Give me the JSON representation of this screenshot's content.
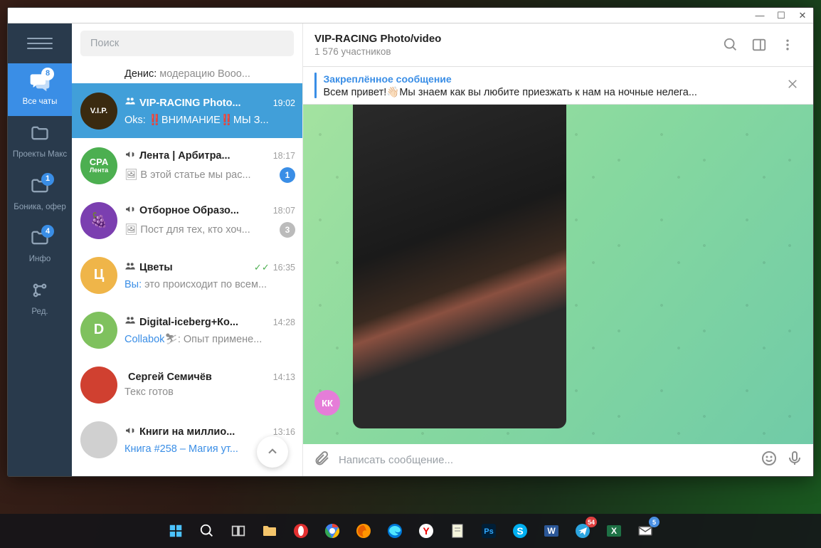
{
  "window_controls": {
    "minimize": "—",
    "maximize": "☐",
    "close": "✕"
  },
  "sidebar": {
    "tabs": [
      {
        "label": "Все чаты",
        "badge": "8",
        "icon": "chats"
      },
      {
        "label": "Проекты Макс",
        "badge": null,
        "icon": "folder"
      },
      {
        "label": "Боника, офер",
        "badge": "1",
        "icon": "folder"
      },
      {
        "label": "Инфо",
        "badge": "4",
        "icon": "folder"
      },
      {
        "label": "Ред.",
        "badge": null,
        "icon": "edit"
      }
    ]
  },
  "search": {
    "placeholder": "Поиск"
  },
  "chats": [
    {
      "type": "partial",
      "msg_html": "<span class='sender'>Денис:</span> модерацию Booo..."
    },
    {
      "type": "selected",
      "avatar": {
        "bg": "#3a2a10",
        "text": "V.I.P."
      },
      "icon": "group",
      "name": "VIP-RACING Photo...",
      "time": "19:02",
      "msg_html": "<span class='sender'>Oks:</span> ‼️ВНИМАНИЕ‼️МЫ З...",
      "badge": null
    },
    {
      "avatar": {
        "bg": "#4caf50",
        "text": "CPA"
      },
      "avatar_sub": "Лента",
      "icon": "channel",
      "name": "Лента | Арбитра...",
      "time": "18:17",
      "msg_html": "🖼 В этой статье мы рас...",
      "badge": "1",
      "badge_blue": true
    },
    {
      "avatar": {
        "bg": "#7b3fb0",
        "text": "🍇"
      },
      "icon": "channel",
      "name": "Отборное Образо...",
      "time": "18:07",
      "msg_html": "🖼 Пост для тех, кто хоч...",
      "badge": "3"
    },
    {
      "avatar": {
        "bg": "#efb549",
        "text": "Ц"
      },
      "icon": "group",
      "name": "Цветы",
      "time": "16:35",
      "check": true,
      "msg_html": "<span class='you'>Вы:</span> это происходит по всем...",
      "badge": null
    },
    {
      "avatar": {
        "bg": "#7fc15e",
        "text": "D"
      },
      "icon": "group",
      "name": "Digital-iceberg+Ко...",
      "time": "14:28",
      "msg_html": "<span class='you'>Collabok</span>⛷: Опыт примене...",
      "badge": null
    },
    {
      "avatar": {
        "bg": "#d04030",
        "text": ""
      },
      "icon": null,
      "name": "Сергей Семичёв",
      "time": "14:13",
      "msg_html": "Текс готов",
      "badge": null
    },
    {
      "avatar": {
        "bg": "#d0d0d0",
        "text": ""
      },
      "icon": "channel",
      "name": "Книги на миллио...",
      "time": "13:16",
      "msg_html": "<span class='you'>Книга #258 – Магия ут...</span>",
      "badge": null
    }
  ],
  "chat_header": {
    "title": "VIP-RACING Photo/video",
    "subtitle": "1 576 участников"
  },
  "pinned": {
    "title": "Закреплённое сообщение",
    "text": "Всем привет!👋🏻Мы знаем как вы любите приезжать к нам на ночные нелега..."
  },
  "sender_badge": "КК",
  "composer": {
    "placeholder": "Написать сообщение..."
  },
  "taskbar": {
    "items": [
      {
        "name": "start",
        "bg": "transparent"
      },
      {
        "name": "search",
        "bg": "transparent"
      },
      {
        "name": "task-view",
        "bg": "transparent"
      },
      {
        "name": "explorer",
        "bg": "#f5c56b"
      },
      {
        "name": "opera",
        "bg": "#e23030"
      },
      {
        "name": "chrome",
        "bg": "#fff"
      },
      {
        "name": "firefox",
        "bg": "#e27c30"
      },
      {
        "name": "edge",
        "bg": "#2b88d8"
      },
      {
        "name": "yandex",
        "bg": "#fff"
      },
      {
        "name": "notepad",
        "bg": "#f5e56b"
      },
      {
        "name": "photoshop",
        "bg": "#2a3a5a"
      },
      {
        "name": "skype",
        "bg": "#00aff0"
      },
      {
        "name": "word",
        "bg": "#2b5797"
      },
      {
        "name": "telegram",
        "bg": "#2ca5e0",
        "badge": "54",
        "badge_class": ""
      },
      {
        "name": "excel",
        "bg": "#1e7145"
      },
      {
        "name": "mail",
        "bg": "#f0f0f0",
        "badge": "5",
        "badge_class": "blue"
      }
    ]
  }
}
